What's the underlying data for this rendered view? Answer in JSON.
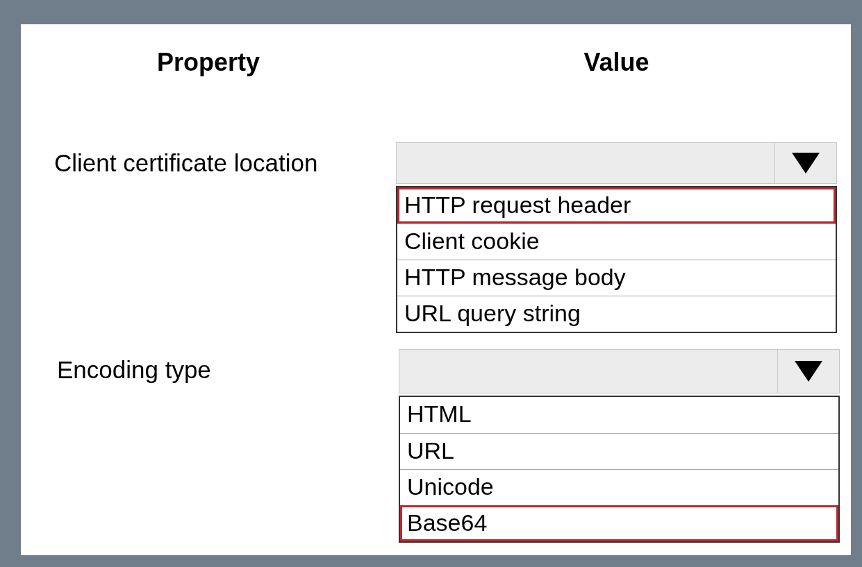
{
  "headers": {
    "property": "Property",
    "value": "Value"
  },
  "rows": [
    {
      "property": "Client certificate location",
      "options": [
        {
          "label": "HTTP request header",
          "selected": true
        },
        {
          "label": "Client cookie",
          "selected": false
        },
        {
          "label": "HTTP message body",
          "selected": false
        },
        {
          "label": "URL query string",
          "selected": false
        }
      ]
    },
    {
      "property": "Encoding type",
      "options": [
        {
          "label": "HTML",
          "selected": false
        },
        {
          "label": "URL",
          "selected": false
        },
        {
          "label": "Unicode",
          "selected": false
        },
        {
          "label": "Base64",
          "selected": true
        }
      ]
    }
  ]
}
